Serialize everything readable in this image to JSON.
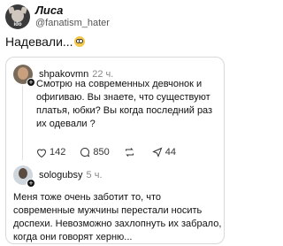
{
  "post": {
    "author_name": "Лиса",
    "author_handle": "@fanatism_hater",
    "avatar_label": "ido",
    "text": "Надевали..."
  },
  "comments": [
    {
      "username": "shpakovmn",
      "time": "22 ч.",
      "text": "Смотрю на современных девчонок и офигиваю. Вы знаете, что существуют платья, юбки? Вы когда последний раз их одевали ?",
      "likes": "142",
      "replies": "850",
      "reposts": "44"
    },
    {
      "username": "sologubsy",
      "time": "5 ч.",
      "text": "Меня тоже очень заботит то, что современные мужчины перестали носить доспехи. Невозможно захлопнуть их забрало, когда они говорят херню..."
    }
  ],
  "icons": [
    "heart-icon",
    "comment-icon",
    "repost-icon",
    "share-icon",
    "follow-plus-icon",
    "eyes-emoji"
  ]
}
